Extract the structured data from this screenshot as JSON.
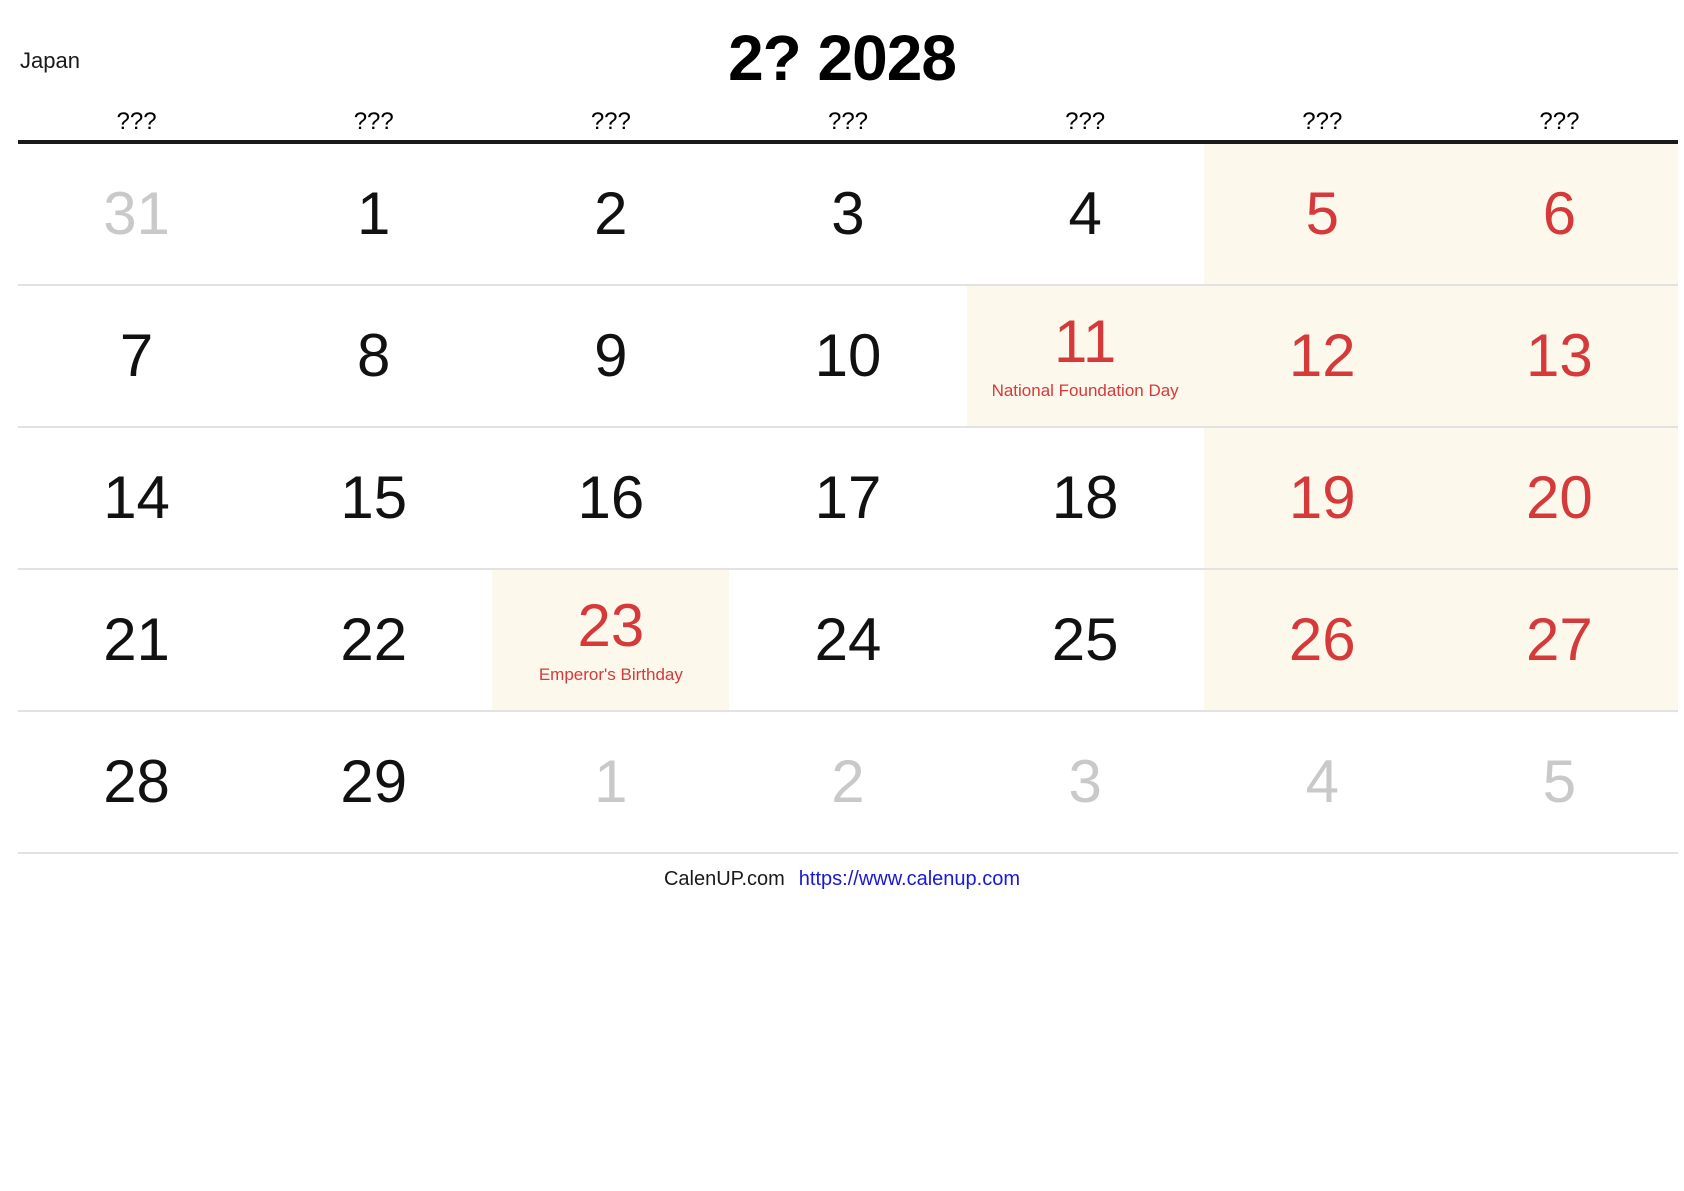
{
  "header": {
    "country": "Japan",
    "title": "2? 2028"
  },
  "weekdays": [
    "???",
    "???",
    "???",
    "???",
    "???",
    "???",
    "???"
  ],
  "colors": {
    "weekend_bg": "#fdf8ec",
    "holiday_text": "#d6393a",
    "muted_text": "#c9c9c9",
    "link": "#1818d8",
    "rule": "#1b1b1b"
  },
  "weeks": [
    [
      {
        "num": "31",
        "style": "muted"
      },
      {
        "num": "1",
        "style": "normal"
      },
      {
        "num": "2",
        "style": "normal"
      },
      {
        "num": "3",
        "style": "normal"
      },
      {
        "num": "4",
        "style": "normal"
      },
      {
        "num": "5",
        "style": "weekend",
        "holiday": ""
      },
      {
        "num": "6",
        "style": "weekend",
        "holiday": ""
      }
    ],
    [
      {
        "num": "7",
        "style": "normal"
      },
      {
        "num": "8",
        "style": "normal"
      },
      {
        "num": "9",
        "style": "normal"
      },
      {
        "num": "10",
        "style": "normal"
      },
      {
        "num": "11",
        "style": "holiday",
        "holiday": "National Foundation Day"
      },
      {
        "num": "12",
        "style": "weekend",
        "holiday": ""
      },
      {
        "num": "13",
        "style": "weekend",
        "holiday": ""
      }
    ],
    [
      {
        "num": "14",
        "style": "normal"
      },
      {
        "num": "15",
        "style": "normal"
      },
      {
        "num": "16",
        "style": "normal"
      },
      {
        "num": "17",
        "style": "normal"
      },
      {
        "num": "18",
        "style": "normal"
      },
      {
        "num": "19",
        "style": "weekend",
        "holiday": ""
      },
      {
        "num": "20",
        "style": "weekend",
        "holiday": ""
      }
    ],
    [
      {
        "num": "21",
        "style": "normal"
      },
      {
        "num": "22",
        "style": "normal"
      },
      {
        "num": "23",
        "style": "holiday",
        "holiday": "Emperor's Birthday"
      },
      {
        "num": "24",
        "style": "normal"
      },
      {
        "num": "25",
        "style": "normal"
      },
      {
        "num": "26",
        "style": "weekend",
        "holiday": ""
      },
      {
        "num": "27",
        "style": "weekend",
        "holiday": ""
      }
    ],
    [
      {
        "num": "28",
        "style": "normal"
      },
      {
        "num": "29",
        "style": "normal"
      },
      {
        "num": "1",
        "style": "muted"
      },
      {
        "num": "2",
        "style": "muted"
      },
      {
        "num": "3",
        "style": "muted"
      },
      {
        "num": "4",
        "style": "muted"
      },
      {
        "num": "5",
        "style": "muted"
      }
    ]
  ],
  "footer": {
    "brand": "CalenUP.com",
    "url": "https://www.calenup.com"
  }
}
